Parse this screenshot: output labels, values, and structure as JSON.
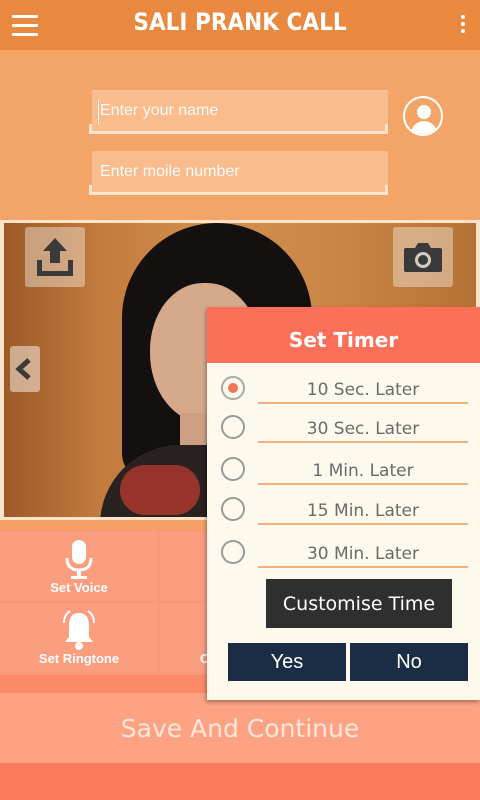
{
  "header": {
    "title": "SALI PRANK CALL",
    "menu_icon": "hamburger-menu-icon",
    "more_icon": "vertical-dots-icon",
    "color": "#e8893f"
  },
  "form": {
    "name_placeholder": "Enter your name",
    "name_value": "",
    "mobile_placeholder": "Enter moile number",
    "mobile_value": "",
    "contact_icon": "contact-person-icon"
  },
  "photo": {
    "upload_icon": "upload-icon",
    "camera_icon": "camera-icon",
    "prev_icon": "chevron-left-icon"
  },
  "options": {
    "set_voice": "Set Voice",
    "set_ringtone": "Set Ringtone",
    "partial_label": "C"
  },
  "save_button": "Save And Continue",
  "timer_dialog": {
    "title": "Set Timer",
    "selected_index": 0,
    "options": [
      {
        "label": "10  Sec. Later",
        "selected": true
      },
      {
        "label": "30  Sec. Later",
        "selected": false
      },
      {
        "label": "1  Min. Later",
        "selected": false
      },
      {
        "label": "15  Min. Later",
        "selected": false
      },
      {
        "label": "30  Min. Later",
        "selected": false
      }
    ],
    "customise_button": "Customise  Time",
    "yes_button": "Yes",
    "no_button": "No"
  },
  "colors": {
    "accent": "#fc705a",
    "button_dark": "#1b2d44",
    "radio_selected": "#f2735a"
  }
}
